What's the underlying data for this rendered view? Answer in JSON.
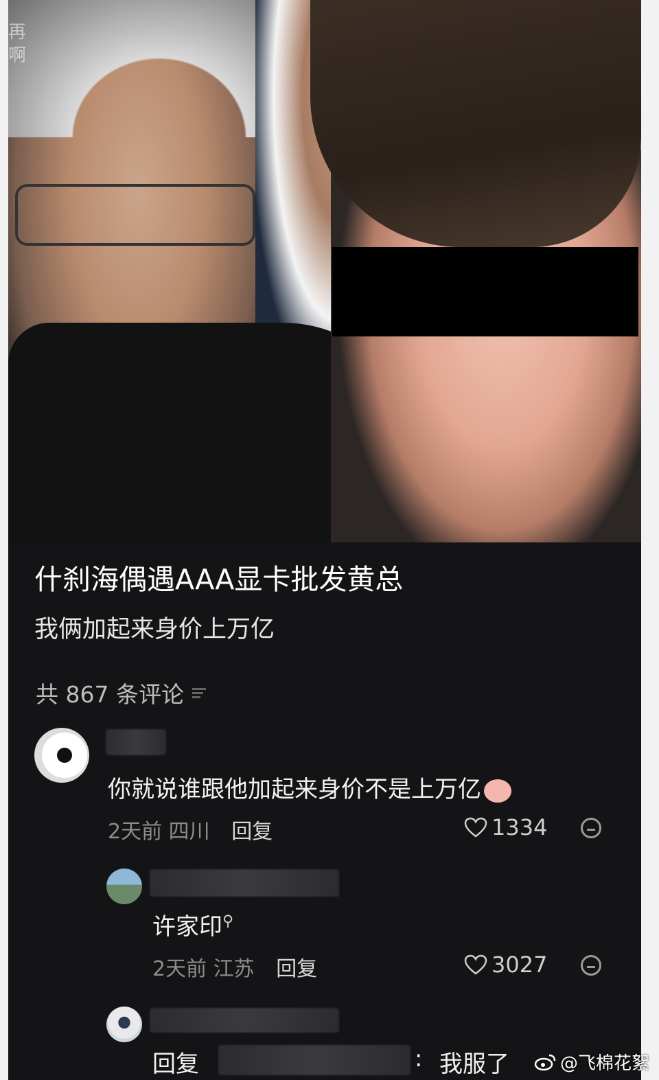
{
  "post": {
    "title": "什刹海偶遇AAA显卡批发黄总",
    "subtitle": "我俩加起来身价上万亿"
  },
  "photo_watermark": {
    "line1": "再",
    "line2": "啊"
  },
  "comments_header": {
    "count_label": "共 867 条评论"
  },
  "comments": [
    {
      "text": "你就说谁跟他加起来身价不是上万亿",
      "time": "2天前",
      "location": "四川",
      "reply_label": "回复",
      "likes": "1334"
    },
    {
      "text": "许家印",
      "time": "2天前",
      "location": "江苏",
      "reply_label": "回复",
      "likes": "3027"
    },
    {
      "prefix": "回复",
      "colon": ":",
      "text": "我服了"
    }
  ],
  "watermark": {
    "text": "@飞棉花絮"
  },
  "colors": {
    "background": "#141416",
    "text_primary": "#ffffff",
    "text_secondary": "#8c8c8c",
    "censor_bar": "#000000"
  }
}
